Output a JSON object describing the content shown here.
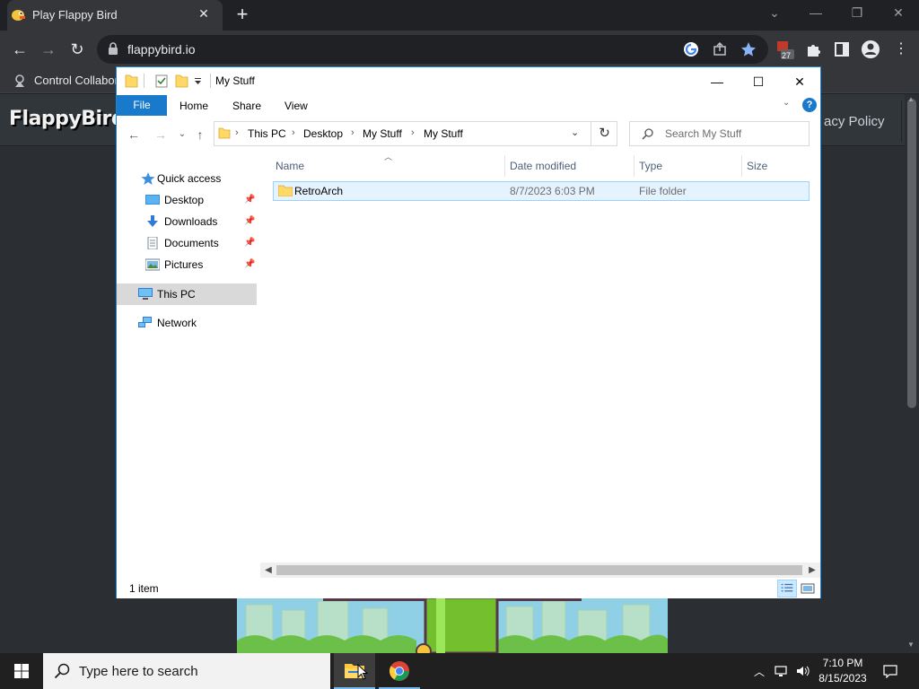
{
  "browser": {
    "tab_title": "Play Flappy Bird",
    "url": "flappybird.io",
    "bookmark_label": "Control Collabora",
    "extension_badge": "27"
  },
  "website": {
    "logo": "FlappyBird",
    "nav_item": "acy Policy"
  },
  "explorer": {
    "window_title": "My Stuff",
    "ribbon": {
      "file": "File",
      "home": "Home",
      "share": "Share",
      "view": "View",
      "help": "?"
    },
    "breadcrumb": [
      "This PC",
      "Desktop",
      "My Stuff",
      "My Stuff"
    ],
    "search_placeholder": "Search My Stuff",
    "nav": {
      "quick_access": "Quick access",
      "desktop": "Desktop",
      "downloads": "Downloads",
      "documents": "Documents",
      "pictures": "Pictures",
      "this_pc": "This PC",
      "network": "Network"
    },
    "columns": {
      "name": "Name",
      "date": "Date modified",
      "type": "Type",
      "size": "Size"
    },
    "files": [
      {
        "name": "RetroArch",
        "date": "8/7/2023 6:03 PM",
        "type": "File folder",
        "size": ""
      }
    ],
    "status": "1 item"
  },
  "taskbar": {
    "search_placeholder": "Type here to search",
    "time": "7:10 PM",
    "date": "8/15/2023"
  },
  "colors": {
    "accent": "#1979ca",
    "selection": "#e5f3ff",
    "folder": "#ffd865"
  }
}
